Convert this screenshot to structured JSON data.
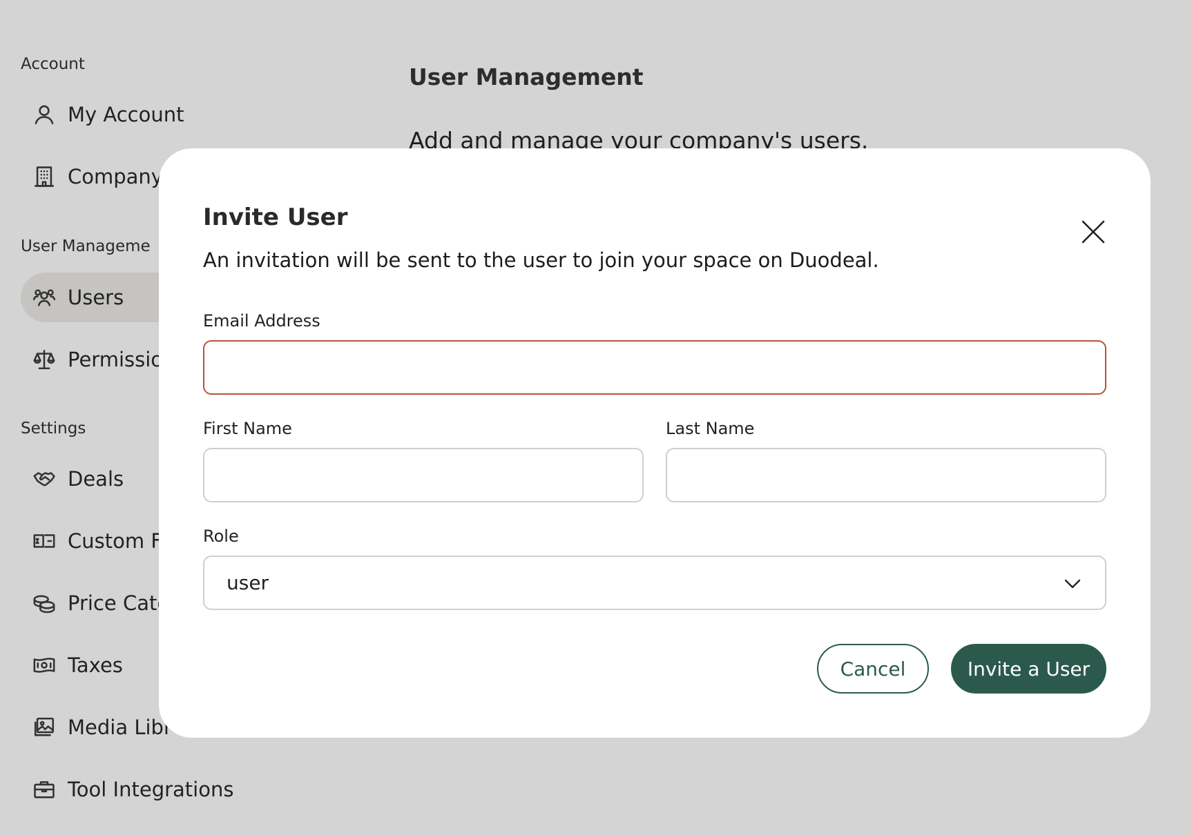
{
  "sidebar": {
    "sections": [
      {
        "title": "Account"
      },
      {
        "title": "User Manageme"
      },
      {
        "title": "Settings"
      }
    ],
    "items": [
      {
        "label": "My Account",
        "icon": "user-icon"
      },
      {
        "label": "Company",
        "icon": "building-icon"
      },
      {
        "label": "Users",
        "icon": "users-icon",
        "active": true
      },
      {
        "label": "Permissio",
        "icon": "scale-icon"
      },
      {
        "label": "Deals",
        "icon": "handshake-icon"
      },
      {
        "label": "Custom F",
        "icon": "custom-fields-icon"
      },
      {
        "label": "Price Cate",
        "icon": "coins-icon"
      },
      {
        "label": "Taxes",
        "icon": "banknote-icon"
      },
      {
        "label": "Media Libr",
        "icon": "image-gallery-icon"
      },
      {
        "label": "Tool Integrations",
        "icon": "briefcase-icon"
      }
    ]
  },
  "main": {
    "title": "User Management",
    "subtitle": "Add and manage your company's users."
  },
  "modal": {
    "title": "Invite User",
    "description": "An invitation will be sent to the user to join your space on Duodeal.",
    "email_label": "Email Address",
    "email_value": "",
    "first_name_label": "First Name",
    "first_name_value": "",
    "last_name_label": "Last Name",
    "last_name_value": "",
    "role_label": "Role",
    "role_value": "user",
    "cancel_label": "Cancel",
    "invite_label": "Invite a User"
  },
  "colors": {
    "accent": "#2b5a4c",
    "error_border": "#b5523a",
    "backdrop": "#d4d4d4",
    "active_item": "#c6c4c1"
  }
}
